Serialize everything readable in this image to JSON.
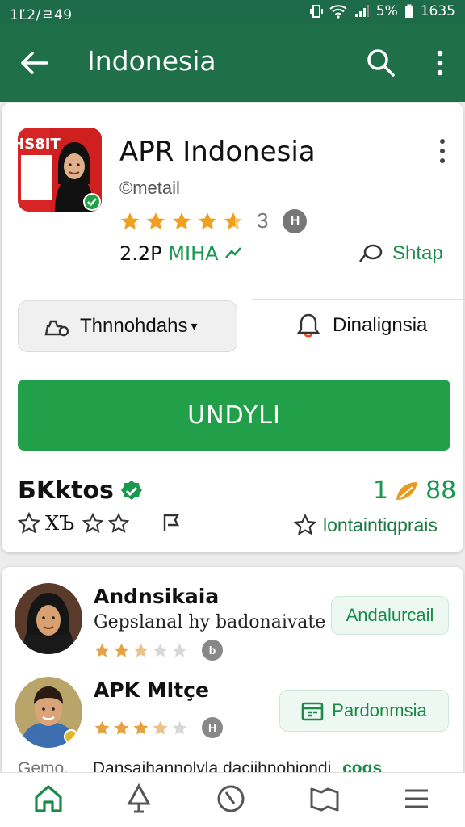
{
  "status_bar": {
    "time": "1Ľ2/ㄹ49",
    "battery_percent": "5%",
    "clock_right": "1635"
  },
  "app_bar": {
    "title": "Indonesia"
  },
  "app": {
    "name": "APR Indonesia",
    "icon_text": "HS8IT",
    "developer": "©metail",
    "rating_stars": 4.5,
    "rating_value": "3",
    "badge_letter": "H",
    "downloads": "2.2P",
    "downloads_label": "MIHA",
    "share_label": "Shtap"
  },
  "actions": {
    "dropdown_label": "Thnnohdahs",
    "secondary_label": "Dinalignsia",
    "install_label": "UNDYLI"
  },
  "section": {
    "title": "ƂKktos",
    "count_left": "1",
    "count_right": "88",
    "ratings_text": "ХЪ",
    "link_label": "lontaintiqprais"
  },
  "list": [
    {
      "title": "Andnsikaia",
      "subtitle": "Gepslanal hy badonaivate",
      "stars": 2.5,
      "badge": "b",
      "button": "Andalurcail"
    },
    {
      "title": "APK Mltçe",
      "subtitle": "",
      "stars": 3.5,
      "badge": "H",
      "button": "Pardonmsia"
    }
  ],
  "footer_row": {
    "prefix": "Gemo.",
    "text": "Dansaihannolyla daciihnohiondi",
    "tag": "cogs"
  },
  "colors": {
    "primary": "#1f7048",
    "accent": "#21a049",
    "star": "#f0a01e"
  }
}
